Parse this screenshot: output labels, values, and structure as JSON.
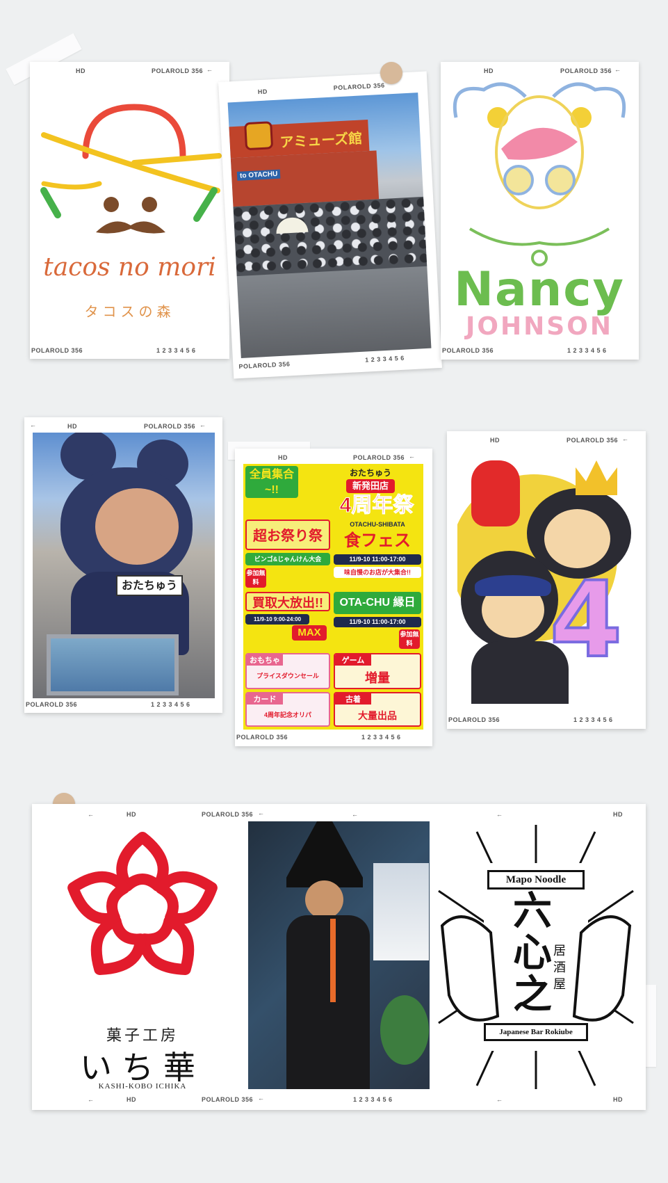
{
  "polaroid": {
    "hd": "HD",
    "brand": "POLAROLD  356",
    "frames": "1 2 3 3 4 5 6",
    "left_arrow": "←",
    "right_arrow": "←"
  },
  "logos": {
    "tacos": {
      "script": "tacos no mori",
      "katakana": "タコスの森"
    },
    "amusement_sign": "アミューズ館",
    "store_sign": "to OTACHU",
    "nancy": {
      "top": "Nancy",
      "bottom": "JOHNSON"
    },
    "mascot_name": "おたちゅう",
    "ichika": {
      "sub": "菓子工房",
      "main": "いち華",
      "roman": "KASHI-KOBO ICHIKA"
    },
    "mapo": {
      "banner_top": "Mapo Noodle",
      "kanji": "六心之",
      "sub": "居酒屋",
      "banner_bottom": "Japanese Bar Rokiube"
    }
  },
  "poster": {
    "top_left": "全員集合~!!",
    "brand": "おたちゅう",
    "store": "新発田店",
    "headline": "4周年祭",
    "fes_title": "OTACHU-SHIBATA",
    "fes_main": "食フェス",
    "fes_date": "11/9-10  11:00-17:00",
    "fes_note": "味自慢のお店が大集合!!",
    "game_fes": "超お祭り祭",
    "janken": "ビンゴ&じゃんけん大会",
    "sale_title": "買取大放出!!",
    "sale_date": "11/9-10  9:00-24:00",
    "sale_max": "MAX",
    "ennichi_title": "OTA-CHU 縁日",
    "ennichi_date": "11/9-10  11:00-17:00",
    "free": "参加無料",
    "toy": "おもちゃ",
    "toy_text": "プライスダウンセール",
    "game": "ゲーム",
    "game_text": "増量",
    "card": "カード",
    "card_text": "4周年記念オリパ",
    "used": "古着",
    "used_text": "大量出品"
  },
  "badge_number": "4",
  "colors": {
    "red": "#e21b2c",
    "yellow": "#f6e313",
    "green": "#4fb94a",
    "navy": "#1f2a4d"
  }
}
